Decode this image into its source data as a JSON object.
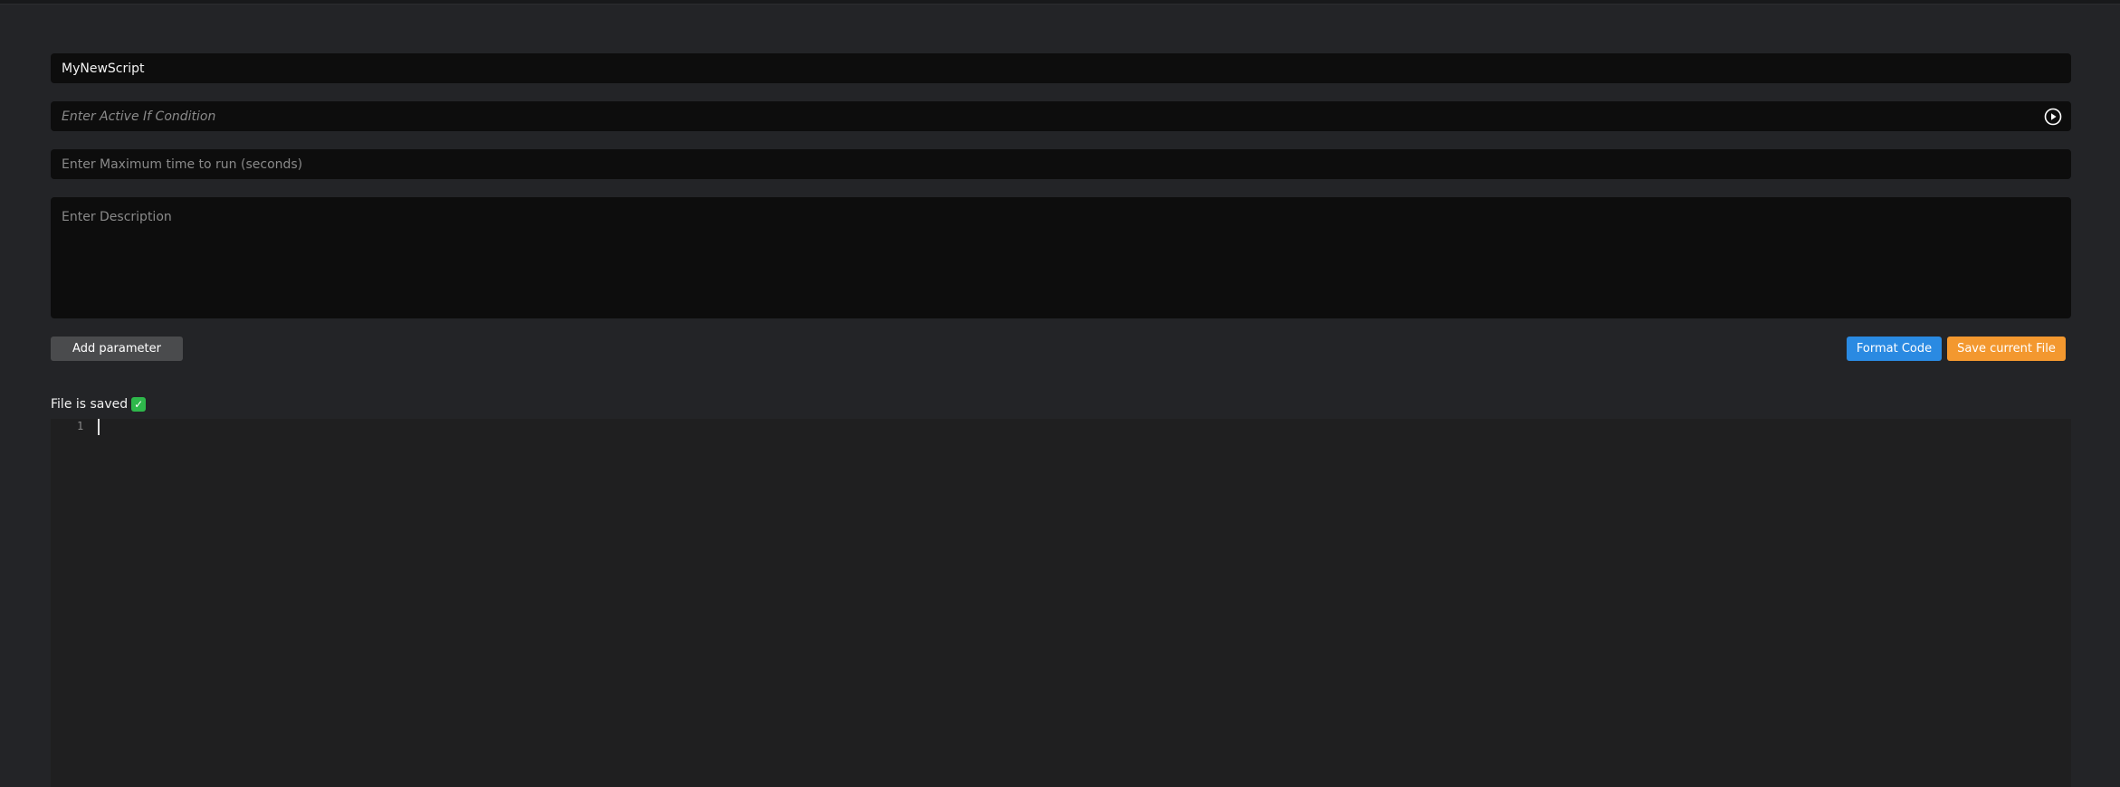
{
  "form": {
    "name_value": "MyNewScript",
    "active_if_placeholder": "Enter Active If Condition",
    "max_time_placeholder": "Enter Maximum time to run (seconds)",
    "description_placeholder": "Enter Description"
  },
  "buttons": {
    "add_parameter": "Add parameter",
    "format_code": "Format Code",
    "save_file": "Save current File"
  },
  "status": {
    "text": "File is saved",
    "icon": "check-mark-icon"
  },
  "editor": {
    "line_numbers": [
      "1"
    ],
    "content": ""
  },
  "colors": {
    "background": "#232427",
    "field_background": "#0d0d0d",
    "format_button": "#2a8ae2",
    "save_button": "#f3982f",
    "add_button": "#4a4b4d",
    "status_check": "#2eb84b"
  }
}
